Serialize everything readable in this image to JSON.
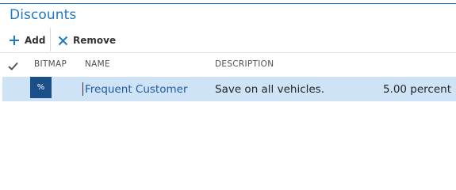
{
  "page": {
    "title": "Discounts"
  },
  "toolbar": {
    "add_label": "Add",
    "remove_label": "Remove"
  },
  "grid": {
    "columns": {
      "bitmap": "BITMAP",
      "name": "NAME",
      "description": "DESCRIPTION"
    },
    "rows": [
      {
        "bitmap": "%",
        "name": "Frequent Customer",
        "description": "Save on all vehicles.",
        "amount": "5.00 percent"
      }
    ]
  },
  "colors": {
    "accent": "#1e78c8",
    "row_selected": "#cfe3f6",
    "bitmap_tile": "#1b4f8a"
  }
}
